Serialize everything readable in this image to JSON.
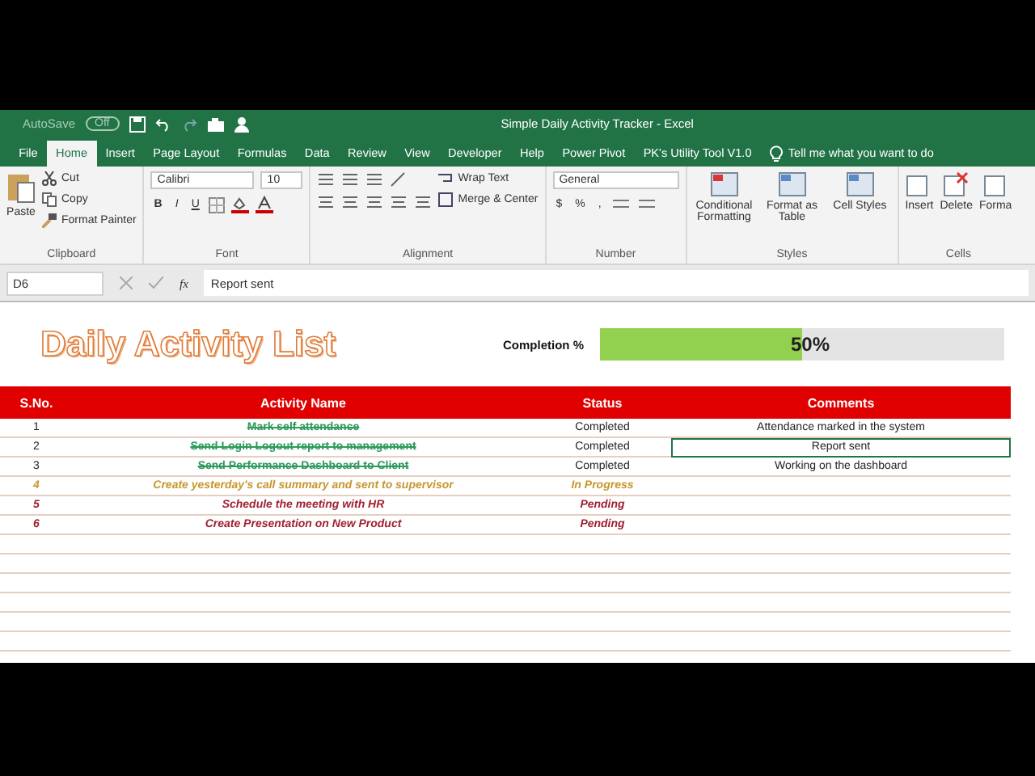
{
  "title_bar": {
    "autosave_label": "AutoSave",
    "autosave_state": "Off",
    "autosave_on": false,
    "title": "Simple Daily Activity Tracker  -  Excel"
  },
  "tabs": [
    {
      "label": "File",
      "selected": false
    },
    {
      "label": "Home",
      "selected": true
    },
    {
      "label": "Insert",
      "selected": false
    },
    {
      "label": "Page Layout",
      "selected": false
    },
    {
      "label": "Formulas",
      "selected": false
    },
    {
      "label": "Data",
      "selected": false
    },
    {
      "label": "Review",
      "selected": false
    },
    {
      "label": "View",
      "selected": false
    },
    {
      "label": "Developer",
      "selected": false
    },
    {
      "label": "Help",
      "selected": false
    },
    {
      "label": "Power Pivot",
      "selected": false
    },
    {
      "label": "PK's Utility Tool V1.0",
      "selected": false
    }
  ],
  "tell_me": "Tell me what you want to do",
  "ribbon": {
    "clipboard": {
      "paste": "Paste",
      "cut": "Cut",
      "copy": "Copy",
      "format_painter": "Format Painter",
      "label": "Clipboard"
    },
    "font": {
      "name": "Calibri",
      "size": "10",
      "bold": "B",
      "italic": "I",
      "underline": "U",
      "label": "Font"
    },
    "alignment": {
      "wrap": "Wrap Text",
      "merge": "Merge & Center",
      "label": "Alignment"
    },
    "number": {
      "format": "General",
      "currency": "$",
      "percent": "%",
      "comma": ",",
      "label": "Number"
    },
    "styles": {
      "items": [
        "Conditional Formatting",
        "Format as Table",
        "Cell Styles"
      ],
      "label": "Styles"
    },
    "cells": {
      "items": [
        "Insert",
        "Delete",
        "Forma"
      ],
      "label": "Cells"
    }
  },
  "formula_bar": {
    "name_box": "D6",
    "fx": "fx",
    "value": "Report sent"
  },
  "sheet": {
    "title": "Daily Activity List",
    "completion_label": "Completion %",
    "completion": {
      "level": 0.5,
      "reading": "50%"
    },
    "columns": [
      "S.No.",
      "Activity Name",
      "Status",
      "Comments"
    ],
    "rows": [
      {
        "no": "1",
        "activity": "Mark self attendance",
        "status": "Completed",
        "comment": "Attendance marked in the system",
        "kind": "completed",
        "selected": false
      },
      {
        "no": "2",
        "activity": "Send Login Logout report to management",
        "status": "Completed",
        "comment": "Report sent",
        "kind": "completed",
        "selected": true
      },
      {
        "no": "3",
        "activity": "Send Performance Dashboard to Client",
        "status": "Completed",
        "comment": "Working on the dashboard",
        "kind": "completed",
        "selected": false
      },
      {
        "no": "4",
        "activity": "Create yesterday's call summary and sent to supervisor",
        "status": "In Progress",
        "comment": "",
        "kind": "in_progress",
        "selected": false
      },
      {
        "no": "5",
        "activity": "Schedule the meeting with HR",
        "status": "Pending",
        "comment": "",
        "kind": "pending",
        "selected": false
      },
      {
        "no": "6",
        "activity": "Create Presentation on New Product",
        "status": "Pending",
        "comment": "",
        "kind": "pending",
        "selected": false
      }
    ]
  }
}
